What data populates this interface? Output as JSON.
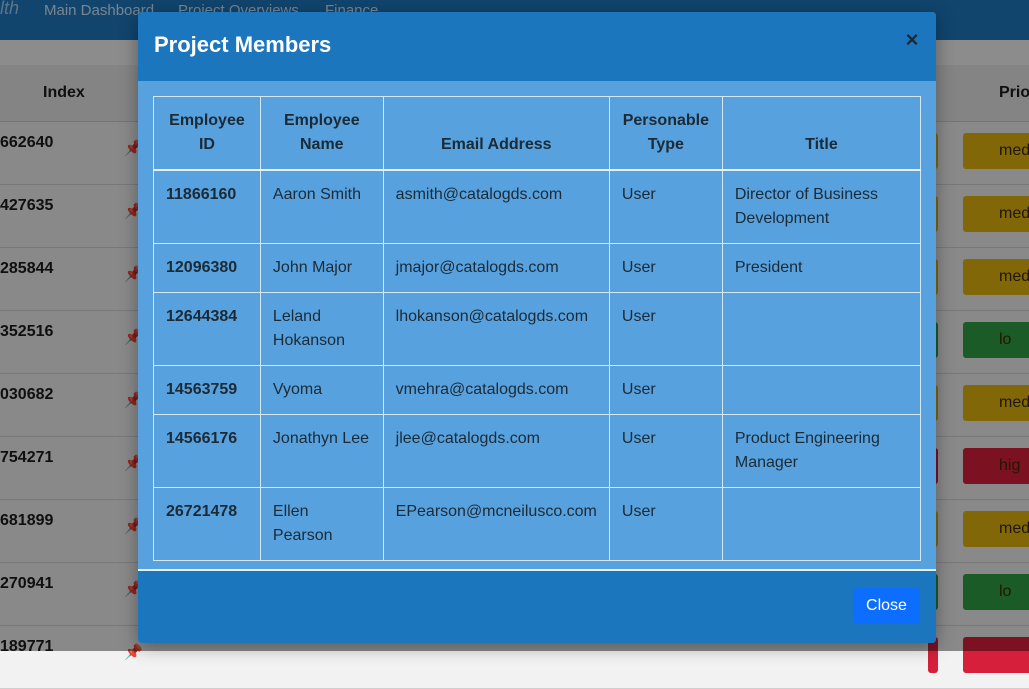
{
  "navbar": {
    "brand": "lth",
    "links": [
      "Main Dashboard",
      "Project Overviews",
      "Finance"
    ]
  },
  "background_table": {
    "headers": {
      "index": "Index",
      "priority": "Prio"
    },
    "rows": [
      {
        "index": "662640",
        "priority": "med",
        "priority_color": "#e0b10e"
      },
      {
        "index": "427635",
        "priority": "med",
        "priority_color": "#e0b10e"
      },
      {
        "index": "285844",
        "priority": "med",
        "priority_color": "#e0b10e"
      },
      {
        "index": "352516",
        "priority": "lo",
        "priority_color": "#2f9e45"
      },
      {
        "index": "030682",
        "priority": "med",
        "priority_color": "#e0b10e"
      },
      {
        "index": "754271",
        "priority": "hig",
        "priority_color": "#d61f3a"
      },
      {
        "index": "681899",
        "priority": "med",
        "priority_color": "#e0b10e"
      },
      {
        "index": "270941",
        "priority": "lo",
        "priority_color": "#2f9e45"
      },
      {
        "index": "189771",
        "priority": "",
        "priority_color": "#d61f3a"
      }
    ]
  },
  "modal": {
    "title": "Project Members",
    "close_icon": "×",
    "close_button_label": "Close",
    "columns": [
      "Employee ID",
      "Employee Name",
      "Email Address",
      "Personable Type",
      "Title"
    ],
    "column_html_lines": [
      [
        "Employee",
        "ID"
      ],
      [
        "Employee",
        "Name"
      ],
      [
        "Email Address"
      ],
      [
        "Personable",
        "Type"
      ],
      [
        "Title"
      ]
    ],
    "members": [
      {
        "id": "11866160",
        "name": "Aaron Smith",
        "email": "asmith@catalogds.com",
        "type": "User",
        "title": "Director of Business Development"
      },
      {
        "id": "12096380",
        "name": "John Major",
        "email": "jmajor@catalogds.com",
        "type": "User",
        "title": "President"
      },
      {
        "id": "12644384",
        "name": "Leland Hokanson",
        "email": "lhokanson@catalogds.com",
        "type": "User",
        "title": ""
      },
      {
        "id": "14563759",
        "name": "Vyoma",
        "email": "vmehra@catalogds.com",
        "type": "User",
        "title": ""
      },
      {
        "id": "14566176",
        "name": "Jonathyn Lee",
        "email": "jlee@catalogds.com",
        "type": "User",
        "title": "Product Engineering Manager"
      },
      {
        "id": "26721478",
        "name": "Ellen Pearson",
        "email": "EPearson@mcneilusco.com",
        "type": "User",
        "title": ""
      }
    ]
  },
  "colors": {
    "modal_header": "#1c76bd",
    "modal_body": "#57a2de",
    "close_button": "#0d6efd",
    "navbar": "#1e78be"
  }
}
